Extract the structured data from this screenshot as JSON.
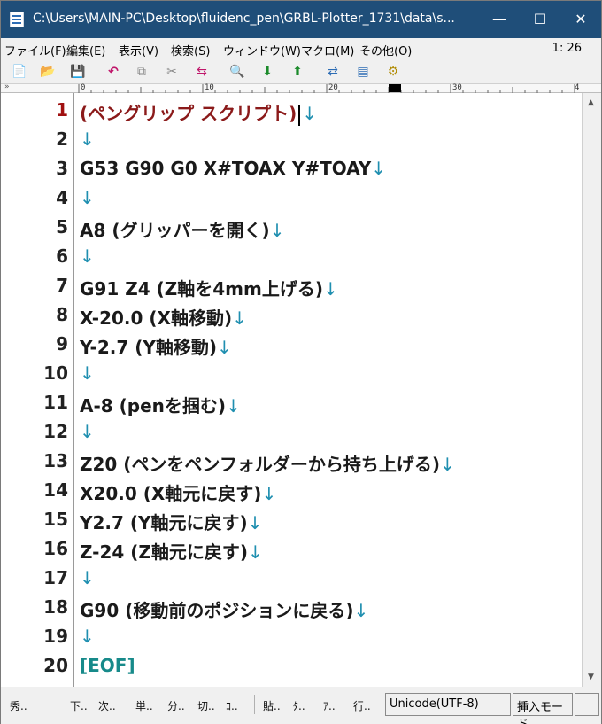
{
  "window": {
    "title": "C:\\Users\\MAIN-PC\\Desktop\\fluidenc_pen\\GRBL-Plotter_1731\\data\\s...",
    "controls": {
      "minimize": "—",
      "maximize": "☐",
      "close": "✕"
    }
  },
  "menu": {
    "items": [
      "ファイル(F)",
      "編集(E)",
      "表示(V)",
      "検索(S)",
      "ウィンドウ(W)",
      "マクロ(M)",
      "その他(O)"
    ],
    "cursor_position": "1: 26"
  },
  "toolbar": {
    "buttons": [
      {
        "name": "new-file-icon",
        "glyph": "📄"
      },
      {
        "name": "open-folder-icon",
        "glyph": "📂"
      },
      {
        "name": "save-icon",
        "glyph": "💾"
      },
      {
        "name": "undo-icon",
        "glyph": "↶"
      },
      {
        "name": "copy-icon",
        "glyph": "⧉"
      },
      {
        "name": "cut-icon",
        "glyph": "✂"
      },
      {
        "name": "paste-icon",
        "glyph": "⇆"
      },
      {
        "name": "search-icon",
        "glyph": "🔍"
      },
      {
        "name": "search-down-icon",
        "glyph": "⬇"
      },
      {
        "name": "search-up-icon",
        "glyph": "⬆"
      },
      {
        "name": "replace-icon",
        "glyph": "⇄"
      },
      {
        "name": "split-window-icon",
        "glyph": "▤"
      },
      {
        "name": "settings-icon",
        "glyph": "⚙"
      }
    ]
  },
  "ruler": {
    "chevron": "»",
    "marks": [
      "0",
      "10",
      "20",
      "30",
      "4"
    ]
  },
  "editor": {
    "newline_glyph": "↓",
    "lines": [
      {
        "num": "1",
        "text": "(ペングリップ スクリプト)",
        "style": "red",
        "caret": true
      },
      {
        "num": "2",
        "text": "",
        "style": ""
      },
      {
        "num": "3",
        "text": "G53 G90 G0 X#TOAX Y#TOAY",
        "style": ""
      },
      {
        "num": "4",
        "text": "",
        "style": ""
      },
      {
        "num": "5",
        "text": "A8  (グリッパーを開く)",
        "style": ""
      },
      {
        "num": "6",
        "text": "",
        "style": ""
      },
      {
        "num": "7",
        "text": "G91 Z4 (Z軸を4mm上げる)",
        "style": ""
      },
      {
        "num": "8",
        "text": "X-20.0 (X軸移動)",
        "style": ""
      },
      {
        "num": "9",
        "text": "Y-2.7   (Y軸移動)",
        "style": ""
      },
      {
        "num": "10",
        "text": "",
        "style": ""
      },
      {
        "num": "11",
        "text": "A-8 (penを掴む)",
        "style": ""
      },
      {
        "num": "12",
        "text": "",
        "style": ""
      },
      {
        "num": "13",
        "text": "Z20   (ペンをペンフォルダーから持ち上げる)",
        "style": ""
      },
      {
        "num": "14",
        "text": "X20.0 (X軸元に戻す)",
        "style": ""
      },
      {
        "num": "15",
        "text": "Y2.7    (Y軸元に戻す)",
        "style": ""
      },
      {
        "num": "16",
        "text": "Z-24  (Z軸元に戻す)",
        "style": ""
      },
      {
        "num": "17",
        "text": "",
        "style": ""
      },
      {
        "num": "18",
        "text": "G90   (移動前のポジションに戻る)",
        "style": ""
      },
      {
        "num": "19",
        "text": "",
        "style": ""
      },
      {
        "num": "20",
        "text": "[EOF]",
        "style": "teal",
        "eof": true
      }
    ]
  },
  "scrollbar": {
    "up": "▲",
    "down": "▼"
  },
  "status": {
    "keys": [
      "秀..",
      "下..",
      "次..",
      "単..",
      "分..",
      "切..",
      "ｺ..",
      "貼..",
      "ﾀ..",
      "ｱ..",
      "行.."
    ],
    "encoding": "Unicode(UTF-8)",
    "mode": "挿入モード"
  },
  "colors": {
    "title_bar": "#1f4e79",
    "comment_red": "#8b1a1a",
    "eof_teal": "#178a8a",
    "newline_blue": "#1f8fb0"
  }
}
